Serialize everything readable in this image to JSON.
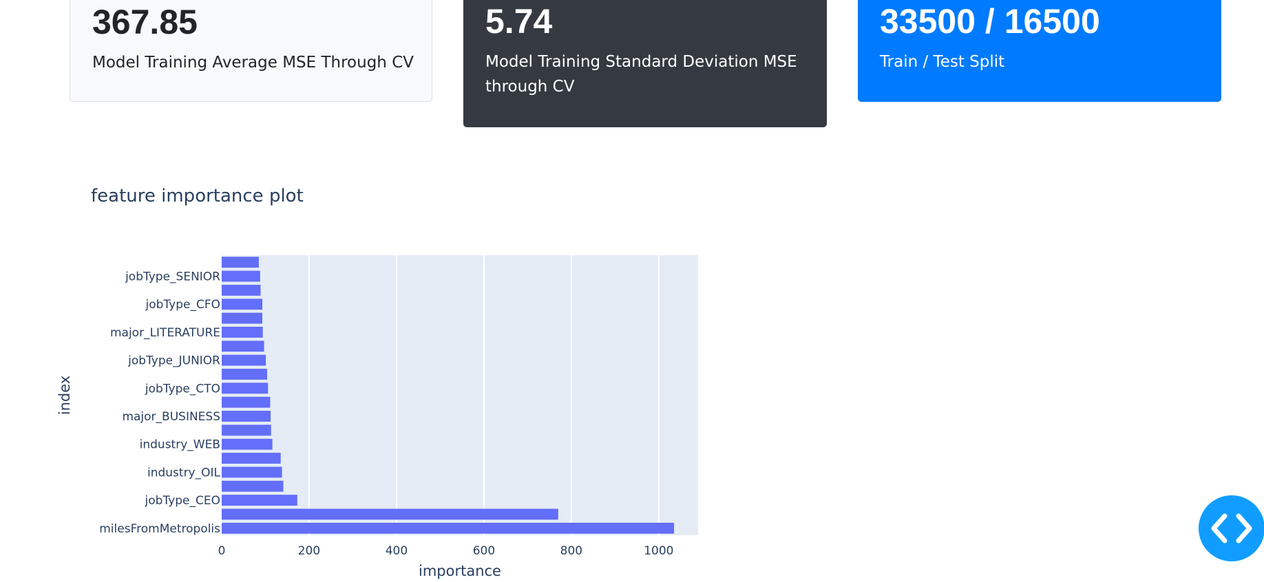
{
  "cards": [
    {
      "value": "367.85",
      "label": "Model Training Average MSE Through CV",
      "color": "#f8f9fa"
    },
    {
      "value": "5.74",
      "label": "Model Training Standard Deviation MSE through CV",
      "color": "#343a40"
    },
    {
      "value": "33500 / 16500",
      "label": "Train / Test Split",
      "color": "#007bff"
    }
  ],
  "chart_data": {
    "type": "bar",
    "orientation": "horizontal",
    "title": "feature importance plot",
    "xlabel": "importance",
    "ylabel": "index",
    "xlim": [
      0,
      1090
    ],
    "xticks": [
      0,
      200,
      400,
      600,
      800,
      1000
    ],
    "grid": true,
    "bar_color": "#636efa",
    "background": "#e5ecf6",
    "bars": [
      {
        "label": "milesFromMetropolis",
        "value": 1035,
        "show_label": true
      },
      {
        "label": "",
        "value": 770,
        "show_label": false
      },
      {
        "label": "jobType_CEO",
        "value": 173,
        "show_label": true
      },
      {
        "label": "",
        "value": 141,
        "show_label": false
      },
      {
        "label": "industry_OIL",
        "value": 138,
        "show_label": true
      },
      {
        "label": "",
        "value": 135,
        "show_label": false
      },
      {
        "label": "industry_WEB",
        "value": 116,
        "show_label": true
      },
      {
        "label": "",
        "value": 113,
        "show_label": false
      },
      {
        "label": "major_BUSINESS",
        "value": 112,
        "show_label": true
      },
      {
        "label": "",
        "value": 111,
        "show_label": false
      },
      {
        "label": "jobType_CTO",
        "value": 106,
        "show_label": true
      },
      {
        "label": "",
        "value": 104,
        "show_label": false
      },
      {
        "label": "jobType_JUNIOR",
        "value": 101,
        "show_label": true
      },
      {
        "label": "",
        "value": 97,
        "show_label": false
      },
      {
        "label": "major_LITERATURE",
        "value": 94,
        "show_label": true
      },
      {
        "label": "",
        "value": 93,
        "show_label": false
      },
      {
        "label": "jobType_CFO",
        "value": 93,
        "show_label": true
      },
      {
        "label": "",
        "value": 89,
        "show_label": false
      },
      {
        "label": "jobType_SENIOR",
        "value": 88,
        "show_label": true
      },
      {
        "label": "",
        "value": 85,
        "show_label": false
      }
    ]
  },
  "code_toggle": {
    "icon": "code-icon"
  }
}
